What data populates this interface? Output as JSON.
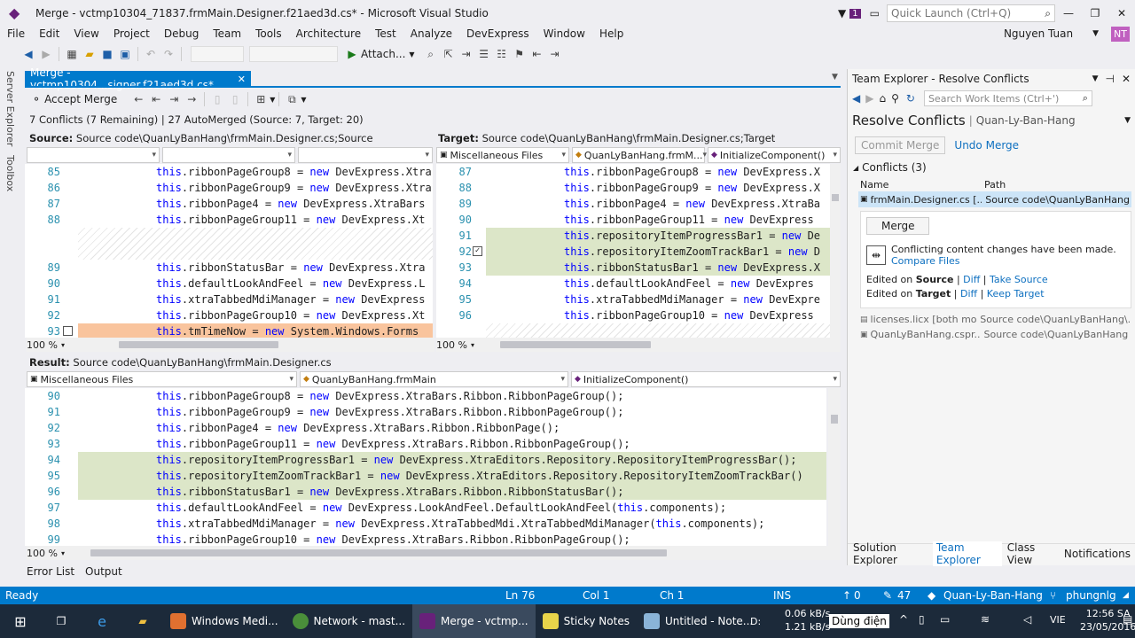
{
  "window": {
    "title": "Merge - vctmp10304_71837.frmMain.Designer.f21aed3d.cs* - Microsoft Visual Studio",
    "notif_count": "1",
    "quick_launch_placeholder": "Quick Launch (Ctrl+Q)",
    "user": "Nguyen Tuan",
    "user_initials": "NT"
  },
  "menu": [
    "File",
    "Edit",
    "View",
    "Project",
    "Debug",
    "Team",
    "Tools",
    "Architecture",
    "Test",
    "Analyze",
    "DevExpress",
    "Window",
    "Help"
  ],
  "toolbar": {
    "attach": "Attach..."
  },
  "rail": {
    "server_explorer": "Server Explorer",
    "toolbox": "Toolbox"
  },
  "doc_tab": {
    "title": "Merge - vctmp10304...signer.f21aed3d.cs*",
    "close": "✕"
  },
  "merge_bar": {
    "accept": "Accept Merge"
  },
  "conflict_summary": "7 Conflicts (7 Remaining) | 27 AutoMerged (Source: 7, Target: 20)",
  "source": {
    "label": "Source:",
    "path": "Source code\\QuanLyBanHang\\frmMain.Designer.cs;Source",
    "zoom": "100 %",
    "lines": [
      {
        "n": "85",
        "t": "this.ribbonPageGroup8 = new DevExpress.Xtra"
      },
      {
        "n": "86",
        "t": "this.ribbonPageGroup9 = new DevExpress.Xtra"
      },
      {
        "n": "87",
        "t": "this.ribbonPage4 = new DevExpress.XtraBars"
      },
      {
        "n": "88",
        "t": "this.ribbonPageGroup11 = new DevExpress.Xt"
      },
      {
        "n": "",
        "t": ""
      },
      {
        "n": "",
        "t": ""
      },
      {
        "n": "89",
        "t": "this.ribbonStatusBar = new DevExpress.Xtra"
      },
      {
        "n": "90",
        "t": "this.defaultLookAndFeel = new DevExpress.L"
      },
      {
        "n": "91",
        "t": "this.xtraTabbedMdiManager = new DevExpress"
      },
      {
        "n": "92",
        "t": "this.ribbonPageGroup10 = new DevExpress.Xt"
      },
      {
        "n": "93",
        "t": "this.tmTimeNow = new System.Windows.Forms"
      }
    ]
  },
  "target": {
    "label": "Target:",
    "path": "Source code\\QuanLyBanHang\\frmMain.Designer.cs;Target",
    "dd1": "Miscellaneous Files",
    "dd2": "QuanLyBanHang.frmM...",
    "dd3": "InitializeComponent()",
    "zoom": "100 %",
    "lines": [
      {
        "n": "87",
        "t": "this.ribbonPageGroup8 = new DevExpress.X"
      },
      {
        "n": "88",
        "t": "this.ribbonPageGroup9 = new DevExpress.X"
      },
      {
        "n": "89",
        "t": "this.ribbonPage4 = new DevExpress.XtraBa"
      },
      {
        "n": "90",
        "t": "this.ribbonPageGroup11 = new DevExpress"
      },
      {
        "n": "91",
        "t": "this.repositoryItemProgressBar1 = new De"
      },
      {
        "n": "92",
        "t": "this.repositoryItemZoomTrackBar1 = new D"
      },
      {
        "n": "93",
        "t": "this.ribbonStatusBar1 = new DevExpress.X"
      },
      {
        "n": "94",
        "t": "this.defaultLookAndFeel = new DevExpres"
      },
      {
        "n": "95",
        "t": "this.xtraTabbedMdiManager = new DevExpre"
      },
      {
        "n": "96",
        "t": "this.ribbonPageGroup10 = new DevExpress"
      }
    ]
  },
  "result": {
    "label": "Result:",
    "path": "Source code\\QuanLyBanHang\\frmMain.Designer.cs",
    "dd1": "Miscellaneous Files",
    "dd2": "QuanLyBanHang.frmMain",
    "dd3": "InitializeComponent()",
    "zoom": "100 %",
    "lines": [
      {
        "n": "90",
        "t": "this.ribbonPageGroup8 = new DevExpress.XtraBars.Ribbon.RibbonPageGroup();"
      },
      {
        "n": "91",
        "t": "this.ribbonPageGroup9 = new DevExpress.XtraBars.Ribbon.RibbonPageGroup();"
      },
      {
        "n": "92",
        "t": "this.ribbonPage4 = new DevExpress.XtraBars.Ribbon.RibbonPage();"
      },
      {
        "n": "93",
        "t": "this.ribbonPageGroup11 = new DevExpress.XtraBars.Ribbon.RibbonPageGroup();"
      },
      {
        "n": "94",
        "t": "this.repositoryItemProgressBar1 = new DevExpress.XtraEditors.Repository.RepositoryItemProgressBar();"
      },
      {
        "n": "95",
        "t": "this.repositoryItemZoomTrackBar1 = new DevExpress.XtraEditors.Repository.RepositoryItemZoomTrackBar()"
      },
      {
        "n": "96",
        "t": "this.ribbonStatusBar1 = new DevExpress.XtraBars.Ribbon.RibbonStatusBar();"
      },
      {
        "n": "97",
        "t": "this.defaultLookAndFeel = new DevExpress.LookAndFeel.DefaultLookAndFeel(this.components);"
      },
      {
        "n": "98",
        "t": "this.xtraTabbedMdiManager = new DevExpress.XtraTabbedMdi.XtraTabbedMdiManager(this.components);"
      },
      {
        "n": "99",
        "t": "this.ribbonPageGroup10 = new DevExpress.XtraBars.Ribbon.RibbonPageGroup();"
      }
    ]
  },
  "team_explorer": {
    "title": "Team Explorer - Resolve Conflicts",
    "search_placeholder": "Search Work Items (Ctrl+')",
    "heading": "Resolve Conflicts",
    "project": "Quan-Ly-Ban-Hang",
    "commit_merge": "Commit Merge",
    "undo_merge": "Undo Merge",
    "conflicts_header": "Conflicts (3)",
    "col_name": "Name",
    "col_path": "Path",
    "files": [
      {
        "name": "frmMain.Designer.cs [...",
        "path": "Source code\\QuanLyBanHang"
      },
      {
        "name": "licenses.licx [both mo...",
        "path": "Source code\\QuanLyBanHang\\..."
      },
      {
        "name": "QuanLyBanHang.cspr...",
        "path": "Source code\\QuanLyBanHang"
      }
    ],
    "merge_button": "Merge",
    "conflict_msg": "Conflicting content changes have been made.",
    "compare_files": "Compare Files",
    "edited_on": "Edited on",
    "source": "Source",
    "target": "Target",
    "diff": "Diff",
    "take_source": "Take Source",
    "keep_target": "Keep Target",
    "tabs": [
      "Solution Explorer",
      "Team Explorer",
      "Class View",
      "Notifications"
    ]
  },
  "bottom_tabs": [
    "Error List",
    "Output"
  ],
  "status": {
    "ready": "Ready",
    "ln": "Ln 76",
    "col": "Col 1",
    "ch": "Ch 1",
    "ins": "INS",
    "up": "0",
    "edits": "47",
    "repo": "Quan-Ly-Ban-Hang",
    "branch": "phungnlg"
  },
  "taskbar": {
    "items": [
      "Windows Medi...",
      "Network - mast...",
      "Merge - vctmp...",
      "Sticky Notes",
      "Untitled - Note..."
    ],
    "drive": "D:",
    "net_up": "0.06 kB/s",
    "net_down": "1.21 kB/s",
    "power": "Dùng điện",
    "lang": "VIE",
    "time": "12:56 SA",
    "date": "23/05/2016"
  },
  "colors": {
    "accent": "#007acc",
    "added": "#dce6c8",
    "conflict": "#f9c49d"
  }
}
